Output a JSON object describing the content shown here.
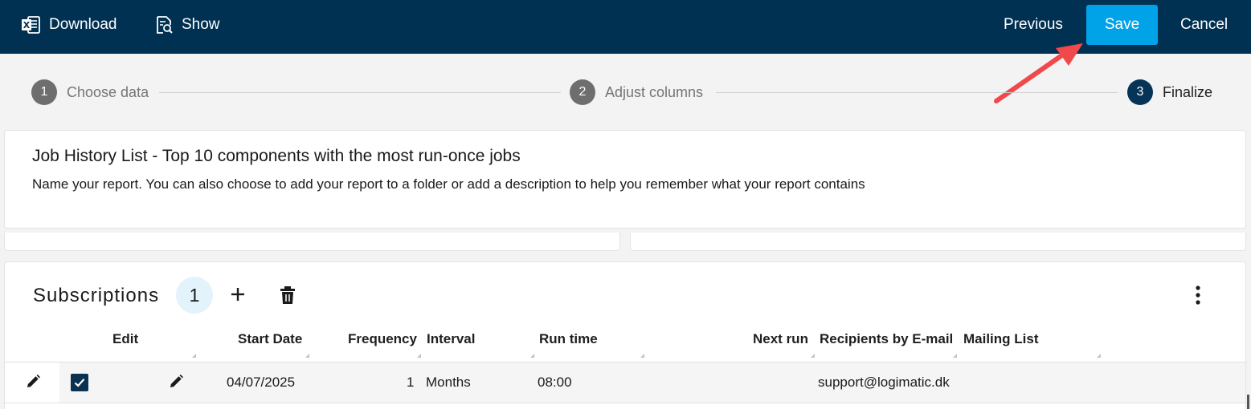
{
  "toolbar": {
    "download_label": "Download",
    "show_label": "Show",
    "previous_label": "Previous",
    "save_label": "Save",
    "cancel_label": "Cancel"
  },
  "stepper": {
    "steps": [
      {
        "number": "1",
        "label": "Choose data",
        "active": false
      },
      {
        "number": "2",
        "label": "Adjust columns",
        "active": false
      },
      {
        "number": "3",
        "label": "Finalize",
        "active": true
      }
    ]
  },
  "report": {
    "title": "Job History List - Top 10 components with the most run-once jobs",
    "description": "Name your report. You can also choose to add your report to a folder or add a description to help you remember what your report contains"
  },
  "subscriptions": {
    "title": "Subscriptions",
    "count": "1",
    "columns": {
      "edit": "Edit",
      "start_date": "Start Date",
      "frequency": "Frequency",
      "interval": "Interval",
      "run_time": "Run time",
      "next_run": "Next run",
      "recipients": "Recipients by E-mail",
      "mailing_list": "Mailing List"
    },
    "rows": [
      {
        "checked": true,
        "start_date": "04/07/2025",
        "frequency": "1",
        "interval": "Months",
        "run_time": "08:00",
        "next_run": "",
        "recipients": "support@logimatic.dk",
        "mailing_list": ""
      }
    ]
  },
  "colors": {
    "topbar": "#003152",
    "save_button": "#00a2e8",
    "active_step": "#063456",
    "annotation_arrow": "#f0484b"
  },
  "icons": {
    "download": "excel-file-icon",
    "show": "document-search-icon",
    "add": "plus-icon",
    "delete": "trash-icon",
    "more": "more-vertical-icon",
    "edit": "pencil-icon",
    "check": "check-icon"
  }
}
